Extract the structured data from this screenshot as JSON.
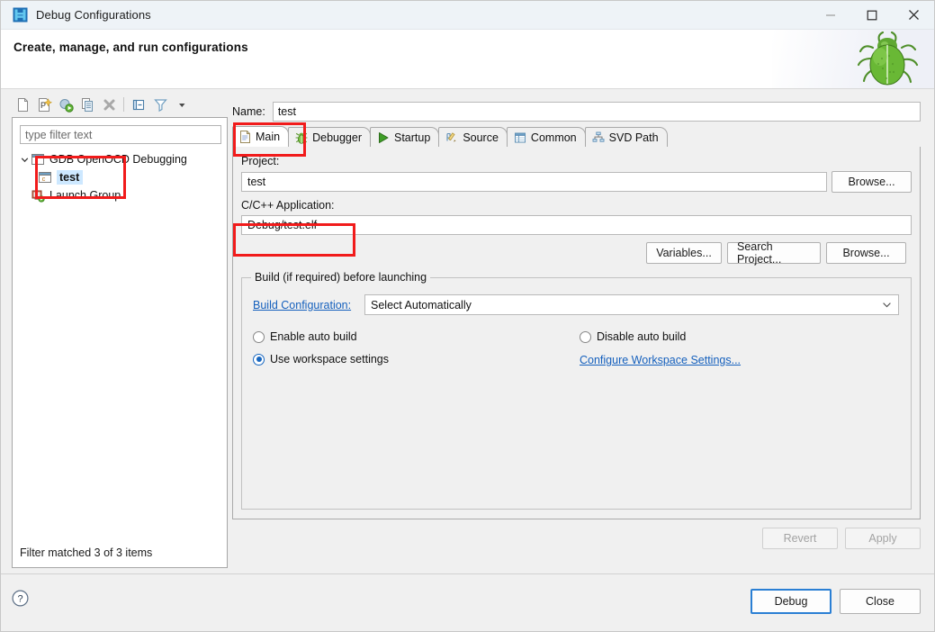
{
  "window": {
    "title": "Debug Configurations",
    "icon": "eclipse-debug-icon",
    "controls": {
      "minimize": "minimize-icon",
      "maximize": "maximize-icon",
      "close": "close-icon"
    }
  },
  "banner": {
    "title": "Create, manage, and run configurations",
    "graphic": "green-bug-icon"
  },
  "left_panel": {
    "toolbar": [
      {
        "name": "new-launch-configuration-icon",
        "tooltip": "New launch configuration"
      },
      {
        "name": "new-prototype-icon",
        "tooltip": "New prototype"
      },
      {
        "name": "export-icon",
        "tooltip": "Export"
      },
      {
        "name": "duplicate-icon",
        "tooltip": "Duplicate"
      },
      {
        "name": "delete-icon",
        "tooltip": "Delete"
      },
      {
        "name": "collapse-all-icon",
        "tooltip": "Collapse All"
      },
      {
        "name": "filter-icon",
        "tooltip": "Filter launch configurations"
      },
      {
        "name": "view-menu-icon",
        "tooltip": "View Menu"
      }
    ],
    "filter_placeholder": "type filter text",
    "filter_value": "",
    "tree": [
      {
        "label": "GDB OpenOCD Debugging",
        "icon": "c-launch-icon",
        "level": 0,
        "expanded": true,
        "selected": false
      },
      {
        "label": "test",
        "icon": "c-launch-icon",
        "level": 1,
        "expanded": false,
        "selected": true
      },
      {
        "label": "Launch Group",
        "icon": "launch-group-icon",
        "level": 0,
        "expanded": false,
        "selected": false
      }
    ],
    "status": "Filter matched 3 of 3 items"
  },
  "right_panel": {
    "name_label": "Name:",
    "name_value": "test",
    "tabs": [
      {
        "label": "Main",
        "icon": "document-icon",
        "active": true
      },
      {
        "label": "Debugger",
        "icon": "bug-icon",
        "active": false
      },
      {
        "label": "Startup",
        "icon": "play-icon",
        "active": false
      },
      {
        "label": "Source",
        "icon": "source-edit-icon",
        "active": false
      },
      {
        "label": "Common",
        "icon": "table-icon",
        "active": false
      },
      {
        "label": "SVD Path",
        "icon": "hierarchy-icon",
        "active": false
      }
    ],
    "main_tab": {
      "project_label": "Project:",
      "project_value": "test",
      "project_browse": "Browse...",
      "application_label": "C/C++ Application:",
      "application_value": "Debug/test.elf",
      "app_buttons": [
        "Variables...",
        "Search Project...",
        "Browse..."
      ],
      "build_group": {
        "legend": "Build (if required) before launching",
        "build_config_label": "Build Configuration:",
        "build_config_value": "Select Automatically",
        "radios": [
          {
            "label": "Enable auto build",
            "checked": false
          },
          {
            "label": "Disable auto build",
            "checked": false
          },
          {
            "label": "Use workspace settings",
            "checked": true
          }
        ],
        "configure_link": "Configure Workspace Settings..."
      }
    },
    "revert_label": "Revert",
    "revert_enabled": false,
    "apply_label": "Apply",
    "apply_enabled": false
  },
  "bottom_bar": {
    "help_icon": "help-icon",
    "debug_label": "Debug",
    "close_label": "Close"
  },
  "annotations": [
    {
      "name": "annotation-main-tab"
    },
    {
      "name": "annotation-tree-items"
    },
    {
      "name": "annotation-application-path"
    }
  ],
  "colors": {
    "annotation": "#f11b1b",
    "accent": "#1867c0",
    "link": "#1560bd",
    "selection": "#cde8ff"
  }
}
